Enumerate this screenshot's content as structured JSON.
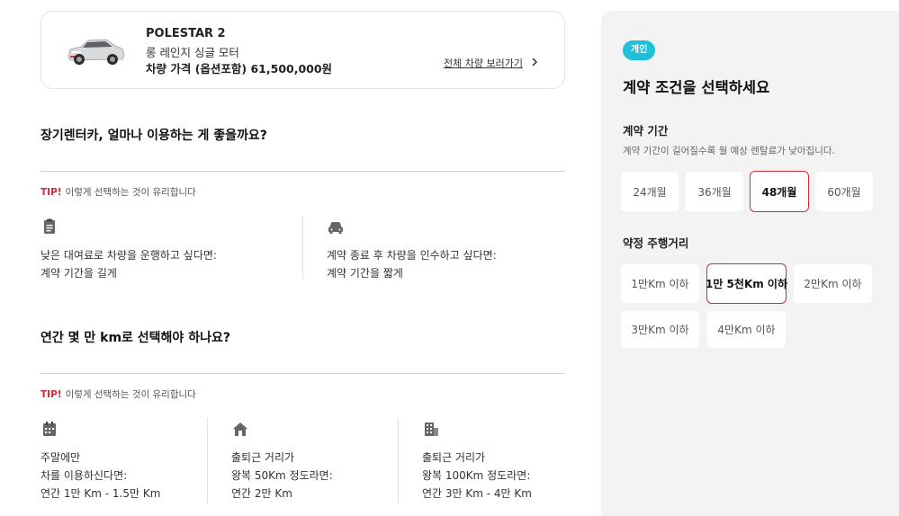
{
  "car": {
    "model": "POLESTAR 2",
    "trim": "롱 레인지 싱글 모터",
    "price_line": "차량 가격 (옵션포함) 61,500,000원",
    "view_all_label": "전체 차량 보러가기",
    "body_color": "#d8dadc"
  },
  "section_period": {
    "title": "장기렌터카, 얼마나 이용하는 게 좋을까요?",
    "tip_label": "TIP!",
    "tip_text": "이렇게 선택하는 것이 유리합니다",
    "items": [
      {
        "icon": "clipboard-icon",
        "line1": "낮은 대여료로 차량을 운행하고 싶다면:",
        "line2": "계약 기간을 길게"
      },
      {
        "icon": "car-icon",
        "line1": "계약 종료 후 차량을 인수하고 싶다면:",
        "line2": "계약 기간을 짧게"
      }
    ]
  },
  "section_mileage": {
    "title": "연간 몇 만 km로 선택해야 하나요?",
    "tip_label": "TIP!",
    "tip_text": "이렇게 선택하는 것이 유리합니다",
    "items": [
      {
        "icon": "calendar-icon",
        "line1": "주말에만",
        "line2": "차를 이용하신다면:",
        "line3": "연간 1만 Km - 1.5만 Km"
      },
      {
        "icon": "house-icon",
        "line1": "출퇴근 거리가",
        "line2": "왕복 50Km 정도라면:",
        "line3": "연간 2만 Km"
      },
      {
        "icon": "building-icon",
        "line1": "출퇴근 거리가",
        "line2": "왕복 100Km 정도라면:",
        "line3": "연간 3만 Km - 4만 Km"
      }
    ]
  },
  "panel": {
    "badge": "개인",
    "title": "계약 조건을 선택하세요",
    "period_label": "계약 기간",
    "period_desc": "계약 기간이 길어질수록 월 예상 렌탈료가 낮아집니다.",
    "period_options": [
      "24개월",
      "36개월",
      "48개월",
      "60개월"
    ],
    "period_selected": "48개월",
    "mileage_label": "약정 주행거리",
    "mileage_options": [
      "1만Km 이하",
      "1만 5천Km 이하",
      "2만Km 이하",
      "3만Km 이하",
      "4만Km 이하"
    ],
    "mileage_selected": "1만 5천Km 이하"
  },
  "colors": {
    "accent_red": "#d42b3a",
    "badge_blue": "#1ec0dc",
    "panel_bg": "#f3f3f3"
  }
}
